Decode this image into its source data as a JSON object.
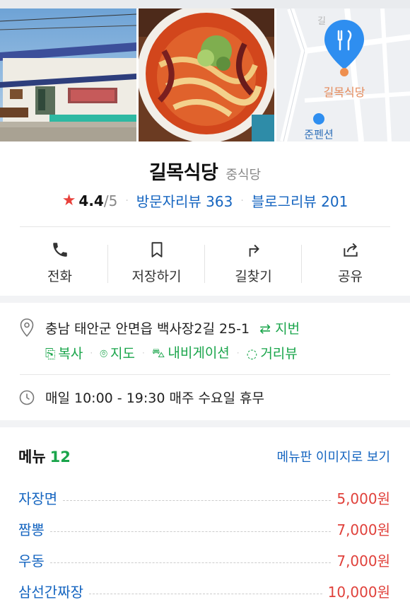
{
  "photos": [
    {
      "icon": "restaurant-exterior-photo"
    },
    {
      "icon": "jjamppong-food-photo"
    },
    {
      "icon": "map-thumbnail",
      "map_pin_label": "길목식당",
      "map_poi_label": "준펜션",
      "map_road_text": "길"
    }
  ],
  "place": {
    "name": "길목식당",
    "category": "중식당",
    "rating": "4.4",
    "rating_max": "/5",
    "visitor_reviews": "방문자리뷰 363",
    "blog_reviews": "블로그리뷰 201"
  },
  "actions": [
    {
      "label": "전화",
      "icon": "phone-icon"
    },
    {
      "label": "저장하기",
      "icon": "bookmark-icon"
    },
    {
      "label": "길찾기",
      "icon": "directions-icon"
    },
    {
      "label": "공유",
      "icon": "share-icon"
    }
  ],
  "info": {
    "address": "충남 태안군 안면읍 백사장2길 25-1",
    "jibun": "지번",
    "copy": "복사",
    "map": "지도",
    "navigation": "내비게이션",
    "street_view": "거리뷰",
    "hours": "매일 10:00 - 19:30 매주 수요일 휴무"
  },
  "menu": {
    "title": "메뉴",
    "count": "12",
    "image_link": "메뉴판 이미지로 보기",
    "items": [
      {
        "name": "자장면",
        "price": "5,000원"
      },
      {
        "name": "짬뽕",
        "price": "7,000원"
      },
      {
        "name": "우동",
        "price": "7,000원"
      },
      {
        "name": "삼선간짜장",
        "price": "10,000원"
      }
    ]
  },
  "colors": {
    "link_blue": "#1565c0",
    "green": "#1aa54b",
    "price_red": "#e0413b",
    "star_red": "#e8413b",
    "map_pin_blue": "#2e8ef0"
  }
}
